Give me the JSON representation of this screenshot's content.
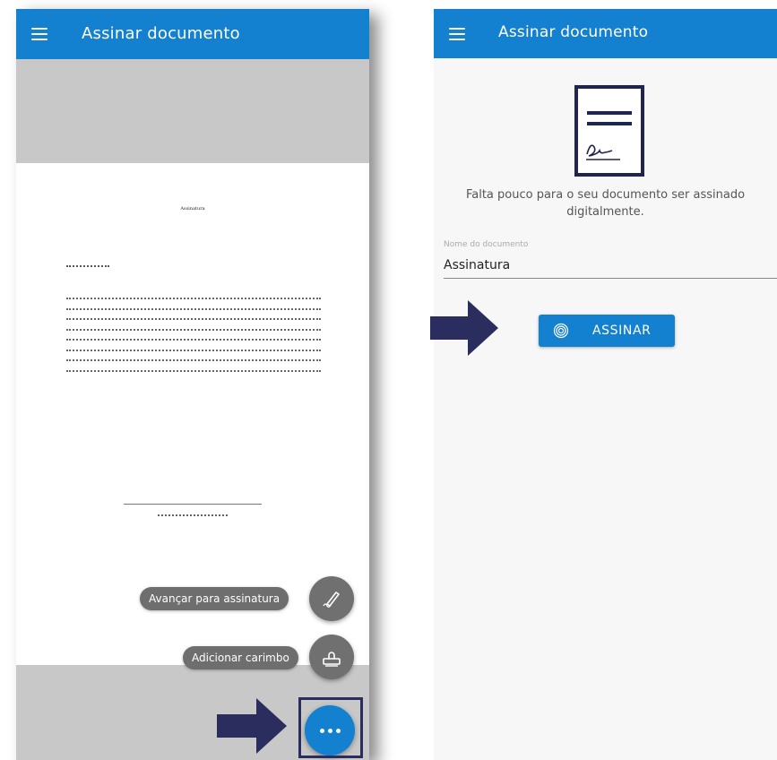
{
  "left_screen": {
    "appbar": {
      "title": "Assinar documento",
      "menu_icon": "hamburger-menu-icon"
    },
    "document": {
      "heading": "Assinatura"
    },
    "fab_menu": {
      "advance_label": "Avançar para assinatura",
      "advance_icon": "pen-signature-icon",
      "stamp_label": "Adicionar carimbo",
      "stamp_icon": "stamp-icon",
      "more_icon": "more-dots-icon"
    }
  },
  "right_screen": {
    "appbar": {
      "title": "Assinar documento",
      "menu_icon": "hamburger-menu-icon"
    },
    "message": "Falta pouco para o seu documento ser assinado digitalmente.",
    "name_field": {
      "label": "Nome do documento",
      "value": "Assinatura"
    },
    "sign_button": {
      "label": "ASSINAR",
      "icon": "fingerprint-icon"
    }
  },
  "colors": {
    "primary_blue": "#1480d0",
    "arrow_navy": "#2a2d5e",
    "fab_gray": "#6e6e6e"
  }
}
